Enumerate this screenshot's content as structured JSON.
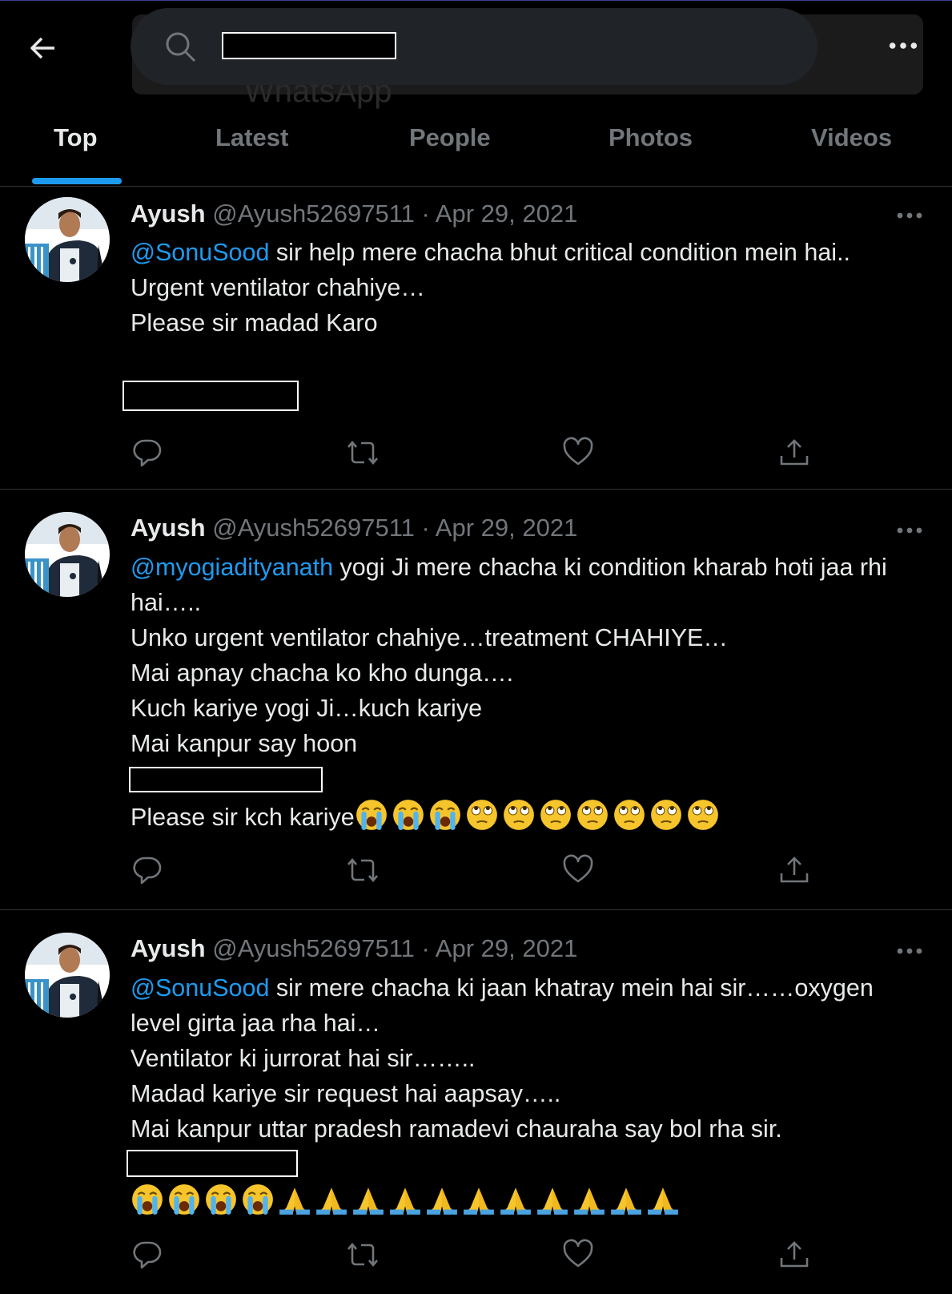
{
  "header": {
    "search_value": "",
    "ghost_text": "WhatsApp",
    "tabs": [
      {
        "label": "Top",
        "active": true
      },
      {
        "label": "Latest",
        "active": false
      },
      {
        "label": "People",
        "active": false
      },
      {
        "label": "Photos",
        "active": false
      },
      {
        "label": "Videos",
        "active": false
      }
    ],
    "icons": [
      "back-arrow-icon",
      "search-icon",
      "more-icon"
    ]
  },
  "colors": {
    "accent": "#1d9bf0",
    "background": "#000000",
    "text": "#e7e9ea",
    "muted": "#71767b"
  },
  "tweets": [
    {
      "name": "Ayush",
      "handle": "@Ayush52697511",
      "separator": "·",
      "date": "Apr 29, 2021",
      "mention": "@SonuSood",
      "first_line_rest": " sir help mere chacha bhut critical condition mein hai..",
      "lines": [
        "Urgent ventilator chahiye…",
        "Please sir madad Karo"
      ],
      "emoji_line": {
        "text": "",
        "emojis": []
      }
    },
    {
      "name": "Ayush",
      "handle": "@Ayush52697511",
      "separator": "·",
      "date": "Apr 29, 2021",
      "mention": "@myogiadityanath",
      "first_line_rest": " yogi Ji mere chacha ki condition kharab hoti jaa rhi hai…..",
      "lines": [
        "Unko urgent ventilator chahiye…treatment CHAHIYE…",
        "Mai apnay chacha ko kho dunga….",
        "Kuch kariye yogi Ji…kuch kariye",
        "Mai kanpur say hoon"
      ],
      "emoji_line": {
        "text": "Please sir kch kariye",
        "emojis": [
          "loudly-crying-face",
          "loudly-crying-face",
          "loudly-crying-face",
          "face-with-rolling-eyes",
          "face-with-rolling-eyes",
          "face-with-rolling-eyes",
          "face-with-rolling-eyes",
          "face-with-rolling-eyes",
          "face-with-rolling-eyes",
          "face-with-rolling-eyes"
        ]
      }
    },
    {
      "name": "Ayush",
      "handle": "@Ayush52697511",
      "separator": "·",
      "date": "Apr 29, 2021",
      "mention": "@SonuSood",
      "first_line_rest": " sir mere chacha ki jaan khatray mein hai sir……oxygen level girta jaa rha hai…",
      "lines": [
        "Ventilator ki jurrorat hai sir……..",
        "Madad kariye sir request hai aapsay…..",
        "Mai kanpur uttar pradesh ramadevi chauraha say bol rha sir."
      ],
      "emoji_line": {
        "text": "",
        "emojis": [
          "loudly-crying-face",
          "loudly-crying-face",
          "loudly-crying-face",
          "loudly-crying-face",
          "folded-hands",
          "folded-hands",
          "folded-hands",
          "folded-hands",
          "folded-hands",
          "folded-hands",
          "folded-hands",
          "folded-hands",
          "folded-hands",
          "folded-hands",
          "folded-hands"
        ]
      }
    }
  ],
  "actions": [
    "reply-icon",
    "retweet-icon",
    "like-icon",
    "share-icon"
  ]
}
